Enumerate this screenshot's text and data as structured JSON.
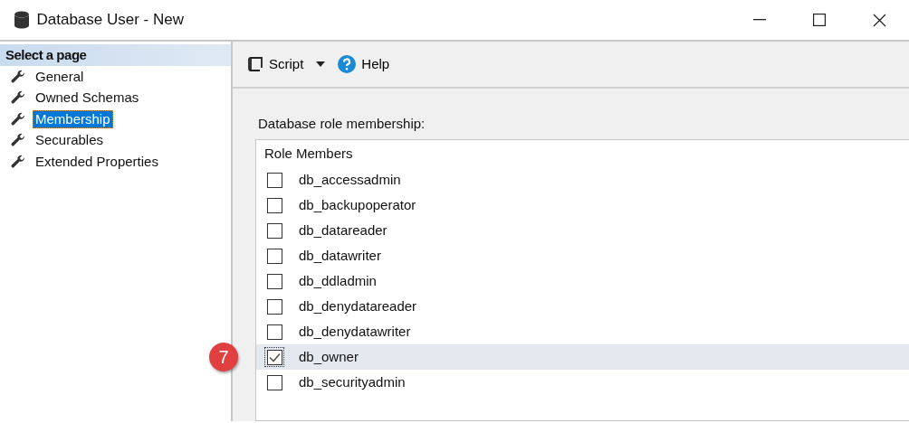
{
  "window": {
    "title": "Database User - New"
  },
  "sidebar": {
    "header": "Select a page",
    "items": [
      {
        "label": "General",
        "selected": false
      },
      {
        "label": "Owned Schemas",
        "selected": false
      },
      {
        "label": "Membership",
        "selected": true
      },
      {
        "label": "Securables",
        "selected": false
      },
      {
        "label": "Extended Properties",
        "selected": false
      }
    ]
  },
  "toolbar": {
    "script": "Script",
    "help": "Help"
  },
  "role_membership": {
    "label": "Database role membership:",
    "column": "Role Members",
    "rows": [
      {
        "name": "db_accessadmin",
        "checked": false,
        "selected": false
      },
      {
        "name": "db_backupoperator",
        "checked": false,
        "selected": false
      },
      {
        "name": "db_datareader",
        "checked": false,
        "selected": false
      },
      {
        "name": "db_datawriter",
        "checked": false,
        "selected": false
      },
      {
        "name": "db_ddladmin",
        "checked": false,
        "selected": false
      },
      {
        "name": "db_denydatareader",
        "checked": false,
        "selected": false
      },
      {
        "name": "db_denydatawriter",
        "checked": false,
        "selected": false
      },
      {
        "name": "db_owner",
        "checked": true,
        "selected": true,
        "callout": "7"
      },
      {
        "name": "db_securityadmin",
        "checked": false,
        "selected": false
      }
    ]
  }
}
